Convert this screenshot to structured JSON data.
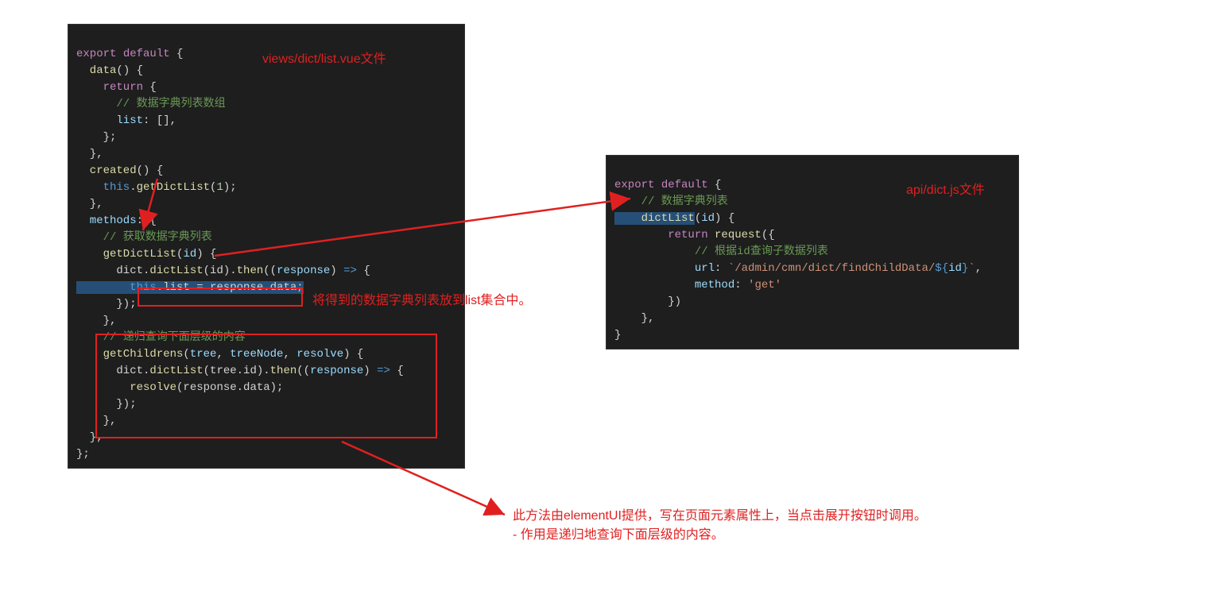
{
  "labels": {
    "leftFile": "views/dict/list.vue文件",
    "rightFile": "api/dict.js文件"
  },
  "annotations": {
    "listNote": "将得到的数据字典列表放到list集合中。",
    "bottom1": "此方法由elementUI提供，写在页面元素属性上，当点击展开按钮时调用。",
    "bottom2": "- 作用是递归地查询下面层级的内容。"
  },
  "codeLeft": {
    "l01a": "export",
    "l01b": " default",
    "l01c": " {",
    "l02a": "  data",
    "l02b": "() {",
    "l03a": "    return",
    "l03b": " {",
    "l04": "      // 数据字典列表数组",
    "l05a": "      list",
    "l05b": ": [],",
    "l06": "    };",
    "l07": "  },",
    "l08a": "  created",
    "l08b": "() {",
    "l09a": "    this",
    "l09b": ".",
    "l09c": "getDictList",
    "l09d": "(",
    "l09e": "1",
    "l09f": ");",
    "l10": "  },",
    "l11a": "  methods",
    "l11b": ": {",
    "l12": "    // 获取数据字典列表",
    "l13a": "    getDictList",
    "l13b": "(",
    "l13c": "id",
    "l13d": ") {",
    "l14a": "      dict.",
    "l14b": "dictList",
    "l14c": "(id).",
    "l14d": "then",
    "l14e": "((",
    "l14f": "response",
    "l14g": ") ",
    "l14h": "=>",
    "l14i": " {",
    "l15a": "        this",
    "l15b": ".list = response.data;",
    "l16": "      });",
    "l17": "    },",
    "l18": "    // 递归查询下面层级的内容",
    "l19a": "    getChildrens",
    "l19b": "(",
    "l19c": "tree",
    "l19d": ", ",
    "l19e": "treeNode",
    "l19f": ", ",
    "l19g": "resolve",
    "l19h": ") {",
    "l20a": "      dict.",
    "l20b": "dictList",
    "l20c": "(tree.id).",
    "l20d": "then",
    "l20e": "((",
    "l20f": "response",
    "l20g": ") ",
    "l20h": "=>",
    "l20i": " {",
    "l21a": "        resolve",
    "l21b": "(response.data);",
    "l22": "      });",
    "l23": "    },",
    "l24": "  },",
    "l25": "};"
  },
  "codeRight": {
    "r01a": "export",
    "r01b": " default",
    "r01c": " {",
    "r02": "    // 数据字典列表",
    "r03a": "    dictList",
    "r03b": "(",
    "r03c": "id",
    "r03d": ") {",
    "r04a": "        return",
    "r04b": " request",
    "r04c": "({",
    "r05": "            // 根据id查询子数据列表",
    "r06a": "            url",
    "r06b": ": ",
    "r06c": "`/admin/cmn/dict/findChildData/",
    "r06d": "${",
    "r06e": "id",
    "r06f": "}",
    "r06g": "`",
    "r06h": ",",
    "r07a": "            method",
    "r07b": ": ",
    "r07c": "'get'",
    "r08": "        })",
    "r09": "    },",
    "r10": "}"
  }
}
